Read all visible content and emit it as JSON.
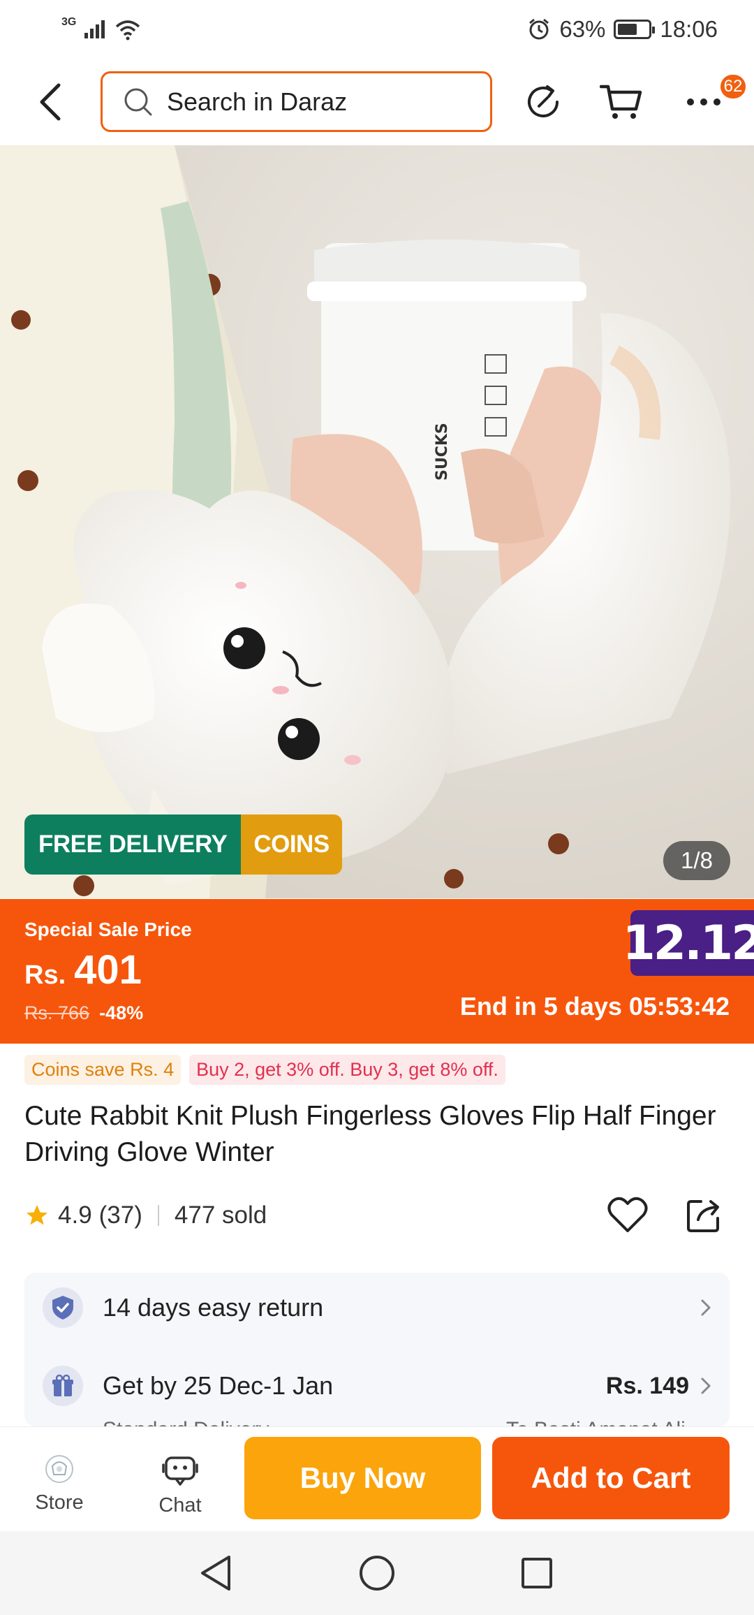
{
  "status_bar": {
    "network": "3G",
    "battery_percent": "63%",
    "time": "18:06",
    "battery_level": 0.63
  },
  "header": {
    "search_placeholder": "Search in Daraz",
    "more_badge_count": "62",
    "accent_color": "#f0600f"
  },
  "gallery": {
    "badge_free_delivery": "FREE DELIVERY",
    "badge_coins": "COINS",
    "image_counter": "1/8"
  },
  "sale": {
    "label": "Special Sale Price",
    "currency": "Rs.",
    "price": "401",
    "original_price": "Rs. 766",
    "discount": "-48%",
    "campaign_badge": "12.12",
    "countdown": "End in 5 days 05:53:42",
    "banner_color": "#f6560c",
    "campaign_color": "#4a1f86"
  },
  "promos": {
    "coins": "Coins save Rs. 4",
    "bundle": "Buy 2, get 3% off. Buy 3, get 8% off."
  },
  "product": {
    "title": "Cute Rabbit Knit Plush Fingerless Gloves Flip Half Finger Driving Glove Winter",
    "rating": "4.9",
    "rating_count": "(37)",
    "sold": "477 sold"
  },
  "services": {
    "return_text": "14 days easy return",
    "delivery_text": "Get by 25 Dec-1 Jan",
    "delivery_fee": "Rs. 149",
    "delivery_sub": "Standard Delivery",
    "delivery_to": "To Basti Amanat Ali"
  },
  "actions": {
    "store_label": "Store",
    "chat_label": "Chat",
    "buy_now": "Buy Now",
    "add_to_cart": "Add to Cart",
    "buy_color": "#fca40c",
    "cart_color": "#f6560c"
  }
}
